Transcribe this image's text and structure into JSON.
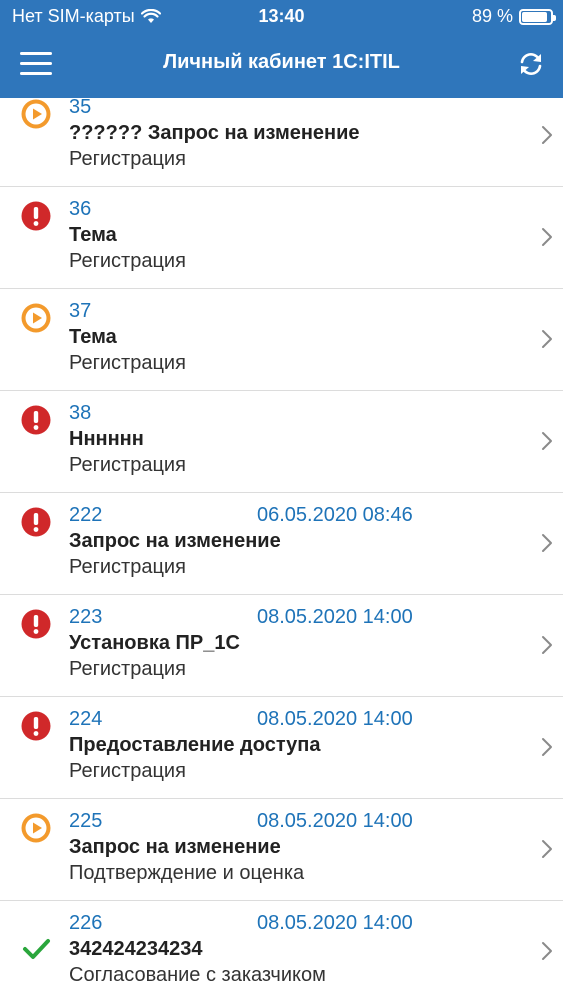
{
  "status_bar": {
    "carrier": "Нет SIM-карты",
    "time": "13:40",
    "battery": "89 %",
    "battery_level": 0.89,
    "wifi_icon": "wifi-icon"
  },
  "nav": {
    "title": "Личный кабинет 1С:ITIL",
    "menu_icon": "hamburger-menu-icon",
    "refresh_icon": "refresh-icon"
  },
  "colors": {
    "header": "#2f76bb",
    "link": "#1e73b8",
    "error": "#d0282a",
    "progress": "#f39a2c",
    "done": "#2aa63c"
  },
  "requests": [
    {
      "number": "35",
      "date": "",
      "title": "?????? Запрос на изменение",
      "state": "Регистрация",
      "status": "in-progress"
    },
    {
      "number": "36",
      "date": "",
      "title": "Тема",
      "state": "Регистрация",
      "status": "error"
    },
    {
      "number": "37",
      "date": "",
      "title": "Тема",
      "state": "Регистрация",
      "status": "in-progress"
    },
    {
      "number": "38",
      "date": "",
      "title": "Нннннн",
      "state": "Регистрация",
      "status": "error"
    },
    {
      "number": "222",
      "date": "06.05.2020 08:46",
      "title": "Запрос на изменение",
      "state": "Регистрация",
      "status": "error"
    },
    {
      "number": "223",
      "date": "08.05.2020 14:00",
      "title": "Установка ПР_1С",
      "state": "Регистрация",
      "status": "error"
    },
    {
      "number": "224",
      "date": "08.05.2020 14:00",
      "title": "Предоставление доступа",
      "state": "Регистрация",
      "status": "error"
    },
    {
      "number": "225",
      "date": "08.05.2020 14:00",
      "title": "Запрос на изменение",
      "state": "Подтверждение и оценка",
      "status": "in-progress"
    },
    {
      "number": "226",
      "date": "08.05.2020 14:00",
      "title": "342424234234",
      "state": "Согласование с заказчиком",
      "status": "done"
    }
  ]
}
